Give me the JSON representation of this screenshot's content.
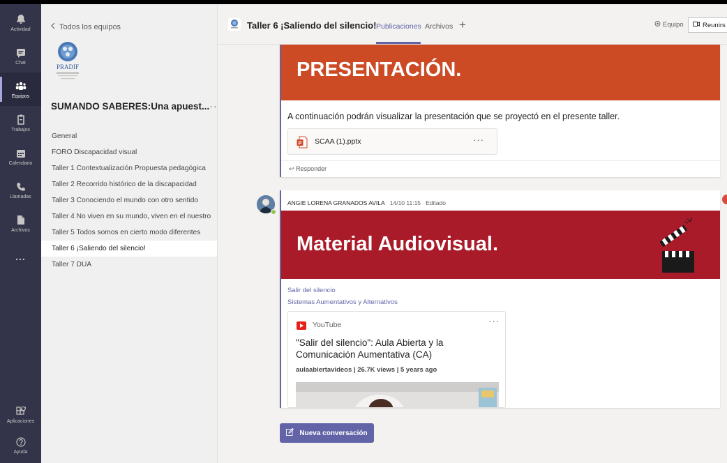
{
  "rail": {
    "items": [
      {
        "label": "Actividad",
        "icon": "bell-icon"
      },
      {
        "label": "Chat",
        "icon": "chat-icon"
      },
      {
        "label": "Equipos",
        "icon": "teams-icon"
      },
      {
        "label": "Trabajos",
        "icon": "assignments-icon"
      },
      {
        "label": "Calendario",
        "icon": "calendar-icon"
      },
      {
        "label": "Llamadas",
        "icon": "phone-icon"
      },
      {
        "label": "Archivos",
        "icon": "file-icon"
      },
      {
        "label": "",
        "icon": "more-icon",
        "glyph": "..."
      }
    ],
    "bottom": [
      {
        "label": "Aplicaciones",
        "icon": "apps-icon"
      },
      {
        "label": "Ayuda",
        "icon": "help-icon"
      }
    ]
  },
  "teams_panel": {
    "back_label": "Todos los equipos",
    "logo_text": "PRADIF",
    "team_name": "SUMANDO SABERES:Una apuest...",
    "more": "···",
    "channels": [
      "General",
      "FORO Discapacidad visual",
      "Taller 1 Contextualización Propuesta pedagógica",
      "Taller 2 Recorrido histórico de la discapacidad",
      "Taller 3 Conociendo el mundo con otro sentido",
      "Taller 4 No viven en su mundo, viven en el nuestro",
      "Taller 5 Todos somos en cierto modo diferentes",
      "Taller 6 ¡Saliendo del silencio!",
      "Taller 7 DUA"
    ],
    "active_channel_index": 7
  },
  "header": {
    "title": "Taller 6 ¡Saliendo del silencio!",
    "tabs": [
      "Publicaciones",
      "Archivos"
    ],
    "add_tab": "+",
    "team_button": "Equipo",
    "meet_button": "Reunirs"
  },
  "posts": {
    "first": {
      "banner": "PRESENTACIÓN.",
      "body": "A continuación podrán visualizar la presentación que se proyectó en el presente taller.",
      "file_name": "SCAA (1).pptx",
      "file_more": "···",
      "reply_label": "Responder"
    },
    "second": {
      "author": "ANGIE LORENA GRANADOS AVILA",
      "timestamp": "14/10 11:15",
      "edited": "Editado",
      "banner": "Material Audiovisual.",
      "link1": "Salir del silencio",
      "link2": "Sistemas Aumentativos y Alternativos",
      "youtube": {
        "source": "YouTube",
        "more": "···",
        "title": "\"Salir del silencio\": Aula Abierta y la Comunicación Aumentativa (CA)",
        "meta": "aulaabiertavideos | 26.7K views | 5 years ago"
      }
    }
  },
  "new_conversation_label": "Nueva conversación",
  "colors": {
    "rail": "#33344a",
    "accent": "#6264a7",
    "banner_presentacion": "#cc4a24",
    "banner_material": "#aa1b2a"
  }
}
